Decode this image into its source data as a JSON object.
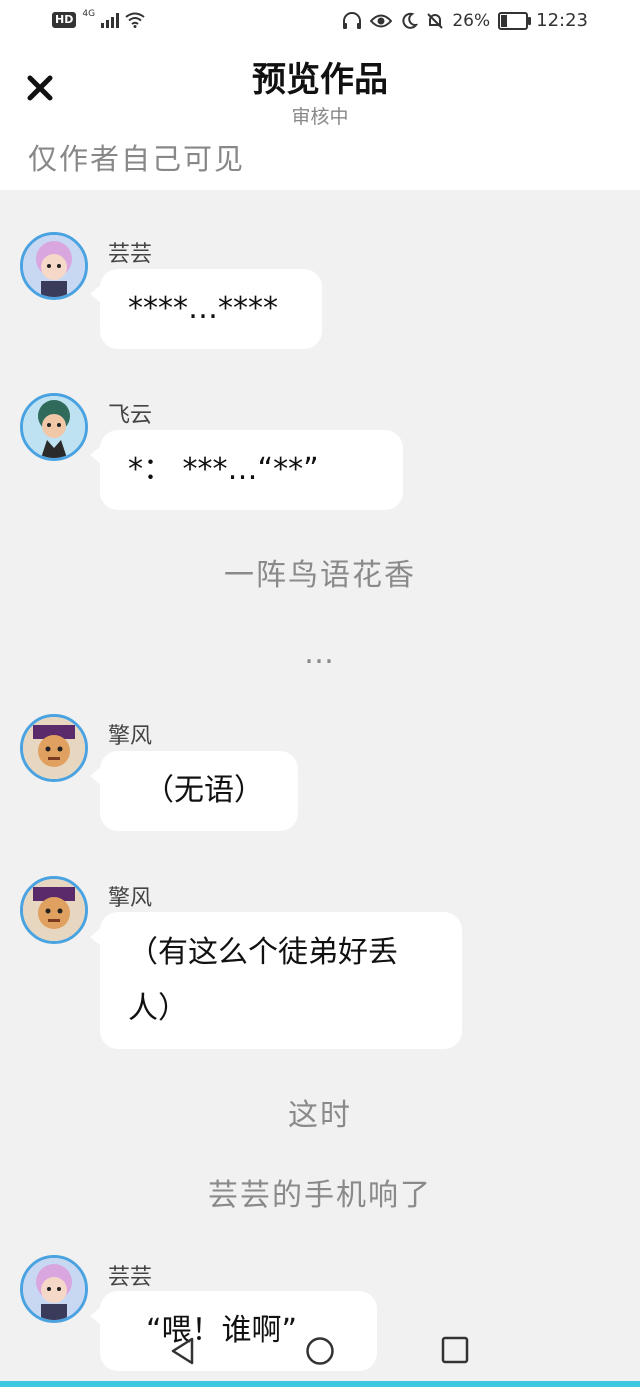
{
  "status_bar": {
    "hd": "HD",
    "network": "4G",
    "battery": "26%",
    "battery_level": 0.26,
    "time": "12:23",
    "icons": [
      "headphones-icon",
      "eye-icon",
      "moon-icon",
      "bell-off-icon"
    ]
  },
  "header": {
    "close_icon": "close-icon",
    "title": "预览作品",
    "subtitle": "审核中",
    "visibility_note": "仅作者自己可见"
  },
  "messages": [
    {
      "type": "chat",
      "name": "芸芸",
      "text": "****…****",
      "avatar": "yunyun-avatar"
    },
    {
      "type": "chat",
      "name": "飞云",
      "text": "*： ***…“**”",
      "avatar": "feiyun-avatar"
    },
    {
      "type": "narration",
      "text": "一阵鸟语花香"
    },
    {
      "type": "narration",
      "text": "…"
    },
    {
      "type": "chat",
      "name": "擎风",
      "text": "（无语）",
      "avatar": "qingfeng-avatar"
    },
    {
      "type": "chat",
      "name": "擎风",
      "text": "（有这么个徒弟好丢人）",
      "avatar": "qingfeng-avatar"
    },
    {
      "type": "narration",
      "text": "这时"
    },
    {
      "type": "narration",
      "text": "芸芸的手机响了"
    },
    {
      "type": "chat",
      "name": "芸芸",
      "text": "“喂！谁啊”",
      "avatar": "yunyun-avatar"
    }
  ],
  "nav": {
    "back_icon": "back-triangle-icon",
    "home_icon": "home-circle-icon",
    "recents_icon": "recents-square-icon"
  },
  "colors": {
    "background": "#f1f1f1",
    "bubble": "#ffffff",
    "avatar_ring": "#4aa3e0",
    "accent_bar": "#3ec8e0"
  }
}
